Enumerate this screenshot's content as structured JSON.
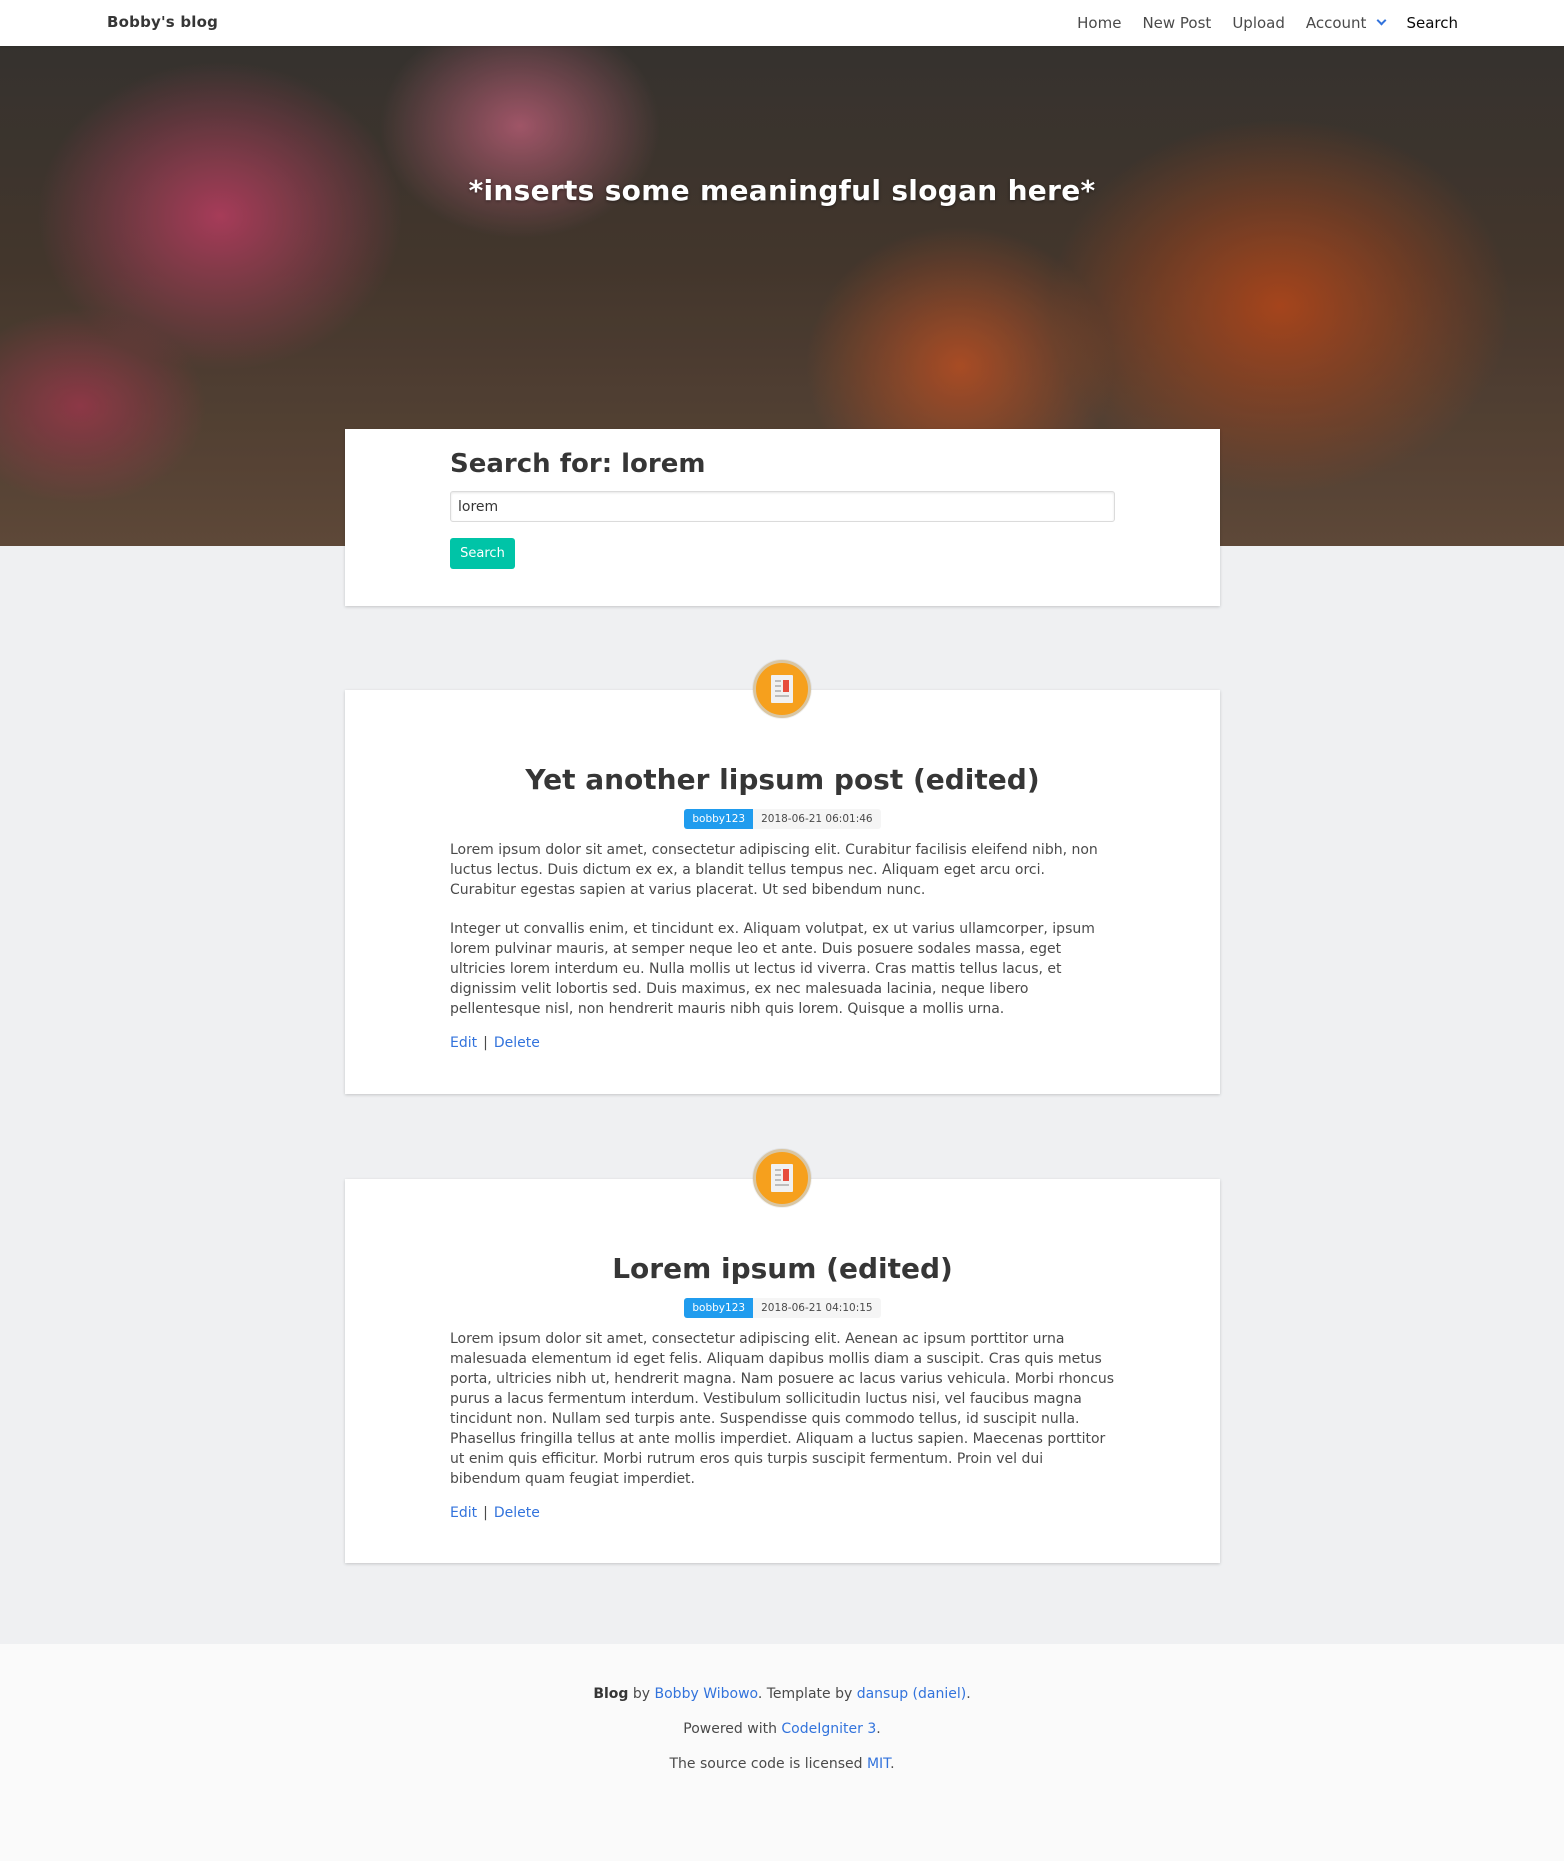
{
  "navbar": {
    "brand": "Bobby's blog",
    "items": [
      {
        "label": "Home"
      },
      {
        "label": "New Post"
      },
      {
        "label": "Upload"
      },
      {
        "label": "Account"
      },
      {
        "label": "Search"
      }
    ]
  },
  "hero": {
    "slogan": "*inserts some meaningful slogan here*"
  },
  "search": {
    "title": "Search for: lorem",
    "value": "lorem",
    "button_label": "Search"
  },
  "posts": [
    {
      "title": "Yet another lipsum post (edited)",
      "author": "bobby123",
      "date": "2018-06-21 06:01:46",
      "paragraphs": [
        "Lorem ipsum dolor sit amet, consectetur adipiscing elit. Curabitur facilisis eleifend nibh, non luctus lectus. Duis dictum ex ex, a blandit tellus tempus nec. Aliquam eget arcu orci. Curabitur egestas sapien at varius placerat. Ut sed bibendum nunc.",
        "Integer ut convallis enim, et tincidunt ex. Aliquam volutpat, ex ut varius ullamcorper, ipsum lorem pulvinar mauris, at semper neque leo et ante. Duis posuere sodales massa, eget ultricies lorem interdum eu. Nulla mollis ut lectus id viverra. Cras mattis tellus lacus, et dignissim velit lobortis sed. Duis maximus, ex nec malesuada lacinia, neque libero pellentesque nisl, non hendrerit mauris nibh quis lorem. Quisque a mollis urna."
      ],
      "edit_label": "Edit",
      "separator": "|",
      "delete_label": "Delete"
    },
    {
      "title": "Lorem ipsum (edited)",
      "author": "bobby123",
      "date": "2018-06-21 04:10:15",
      "paragraphs": [
        "Lorem ipsum dolor sit amet, consectetur adipiscing elit. Aenean ac ipsum porttitor urna malesuada elementum id eget felis. Aliquam dapibus mollis diam a suscipit. Cras quis metus porta, ultricies nibh ut, hendrerit magna. Nam posuere ac lacus varius vehicula. Morbi rhoncus purus a lacus fermentum interdum. Vestibulum sollicitudin luctus nisi, vel faucibus magna tincidunt non. Nullam sed turpis ante. Suspendisse quis commodo tellus, id suscipit nulla. Phasellus fringilla tellus at ante mollis imperdiet. Aliquam a luctus sapien. Maecenas porttitor ut enim quis efficitur. Morbi rutrum eros quis turpis suscipit fermentum. Proin vel dui bibendum quam feugiat imperdiet."
      ],
      "edit_label": "Edit",
      "separator": "|",
      "delete_label": "Delete"
    }
  ],
  "footer": {
    "line1": {
      "blog": "Blog",
      "by": " by ",
      "author": "Bobby Wibowo",
      "template_by": ". Template by ",
      "template_author": "dansup (daniel)",
      "end": "."
    },
    "line2": {
      "prefix": "Powered with ",
      "framework": "CodeIgniter 3",
      "end": "."
    },
    "line3": {
      "prefix": "The source code is licensed ",
      "license": "MIT",
      "end": "."
    }
  },
  "colors": {
    "primary_link": "#3273dc",
    "search_button": "#00c4a7",
    "author_tag": "#209cee",
    "post_icon": "#f6a01d"
  },
  "icons": {
    "post_icon": "document-icon",
    "account_dropdown": "chevron-down-icon"
  }
}
